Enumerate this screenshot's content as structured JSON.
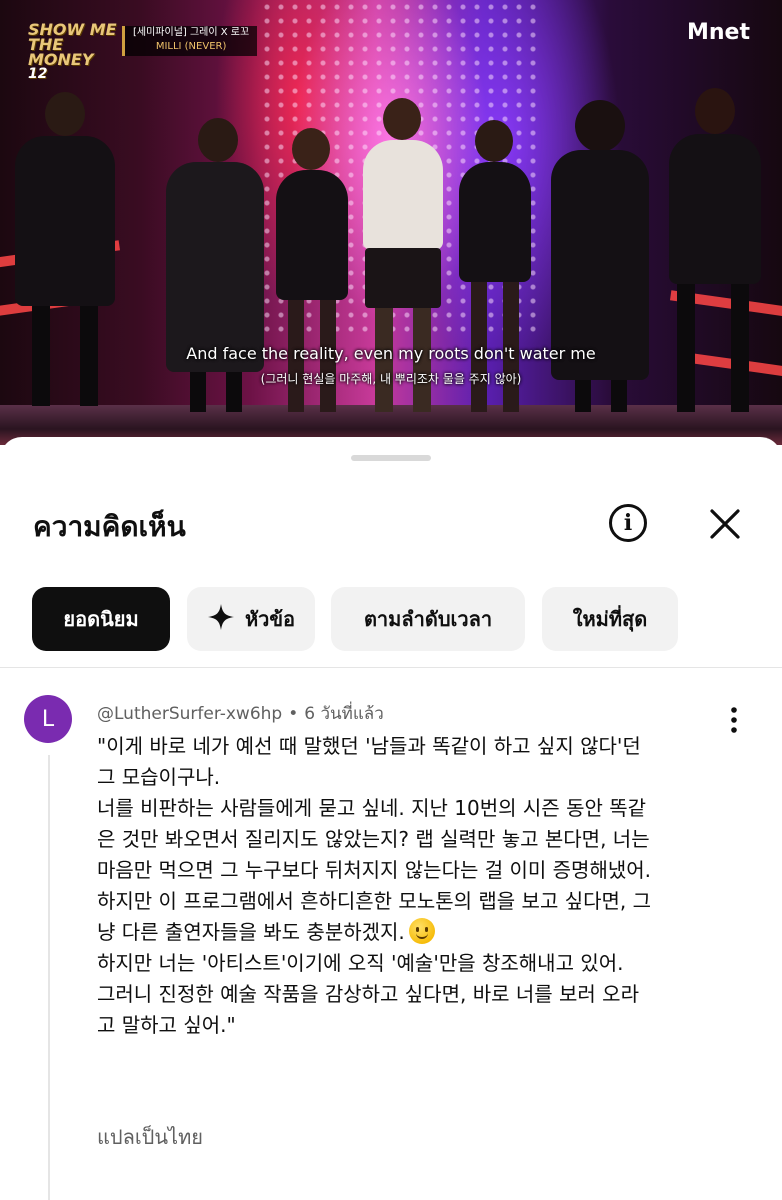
{
  "video": {
    "show_logo": [
      "SHOW ME",
      "THE MONEY",
      "12"
    ],
    "info_tag": {
      "line1": "[세미파이널] 그레이 X 로꼬",
      "line2": "MILLI (NEVER)"
    },
    "channel_logo": "Mnet",
    "subtitle_en": "And face the reality, even my roots don't water me",
    "subtitle_ko": "(그러니 현실을 마주해, 내 뿌리조차 물을 주지 않아)"
  },
  "sheet": {
    "title": "ความคิดเห็น",
    "info_icon": "info-icon",
    "close_icon": "close-icon",
    "chips": [
      {
        "label": "ยอดนิยม",
        "active": true
      },
      {
        "label": "หัวข้อ",
        "active": false,
        "icon": "sparkle-icon"
      },
      {
        "label": "ตามลำดับเวลา",
        "active": false
      },
      {
        "label": "ใหม่ที่สุด",
        "active": false
      }
    ]
  },
  "comment": {
    "avatar_letter": "L",
    "avatar_color": "#7a2bb0",
    "author": "@LutherSurfer-xw6hp",
    "time": "6 วันที่แล้ว",
    "lines": [
      "\"이게 바로 네가 예선 때 말했던 '남들과 똑같이 하고 싶지 않다'던",
      "그 모습이구나.",
      "너를 비판하는 사람들에게 묻고 싶네. 지난 10번의 시즌 동안 똑같",
      "은 것만 봐오면서 질리지도 않았는지? 랩 실력만 놓고 본다면, 너는",
      "마음만 먹으면 그 누구보다 뒤처지지 않는다는 걸 이미 증명해냈어.",
      "하지만 이 프로그램에서 흔하디흔한 모노톤의 랩을 보고 싶다면, 그",
      "냥 다른 출연자들을 봐도 충분하겠지.",
      "하지만 너는 '아티스트'이기에 오직 '예술'만을 창조해내고 있어.",
      "그러니 진정한 예술 작품을 감상하고 싶다면, 바로 너를 보러 오라",
      "고 말하고 싶어.\""
    ],
    "emoji": "smiling-face-icon",
    "translate_label": "แปลเป็นไทย"
  }
}
